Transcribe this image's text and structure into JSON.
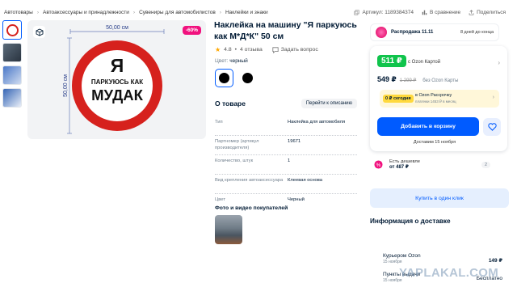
{
  "breadcrumbs": [
    "Автотовары",
    "Автоаксессуары и принадлежности",
    "Сувениры для автомобилистов",
    "Наклейки и знаки"
  ],
  "header_right": {
    "sku": "Артикул: 1189384374",
    "compare": "В сравнение",
    "share": "Поделиться"
  },
  "gallery": {
    "discount_badge": "-60%",
    "image": {
      "width_label": "50,00 см",
      "height_label": "50,00 см",
      "sign_line1": "Я",
      "sign_line2": "ПАРКУЮСЬ КАК",
      "sign_line3": "МУДАК"
    }
  },
  "product": {
    "title": "Наклейка на машину \"Я паркуюсь как М*Д*К\" 50 см",
    "rating": "4.8",
    "reviews": "4 отзыва",
    "ask": "Задать вопрос",
    "color_label": "Цвет:",
    "color_value": "черный"
  },
  "about": {
    "heading": "О товаре",
    "to_description": "Перейти к описанию",
    "specs": [
      {
        "k": "Тип",
        "v": "Наклейка для автомобиля"
      },
      {
        "k": "Партномер (артикул производителя)",
        "v": "19671"
      },
      {
        "k": "Количество, штук",
        "v": "1"
      },
      {
        "k": "Вид крепления автоаксессуара",
        "v": "Клеевая основа"
      },
      {
        "k": "Цвет",
        "v": "Черный"
      }
    ],
    "photos_heading": "Фото и видео покупателей"
  },
  "sidebar": {
    "sale": {
      "title": "Распродажа 11.11",
      "days": "8 дней до конца"
    },
    "ozon_price": "511 ₽",
    "ozon_card": "с Ozon Картой",
    "price": "549 ₽",
    "old_price": "1 299 ₽",
    "without_card": "без Ozon Карты",
    "installment": {
      "tag": "0 ₽ сегодня",
      "line1": "в Ozon Рассрочку",
      "line2": "платежи 1453 ₽ в месяц"
    },
    "add_to_cart": "Добавить в корзину",
    "delivery_date": "Доставим 15 ноября",
    "cheaper": {
      "label": "Есть дешевле",
      "price": "от 487 ₽",
      "count": "2"
    },
    "one_click": "Купить в один клик",
    "delivery_heading": "Информация о доставке",
    "options": [
      {
        "name": "Курьером Ozon",
        "date": "15 ноября",
        "price": "149 ₽"
      },
      {
        "name": "Пункты выдачи",
        "date": "15 ноября",
        "price": "Бесплатно"
      }
    ]
  },
  "watermark": "YAPLAKAL.COM",
  "colors": {
    "accent": "#005bff",
    "green": "#10c44c",
    "pink": "#f1117e",
    "sign_red": "#d6211d"
  }
}
